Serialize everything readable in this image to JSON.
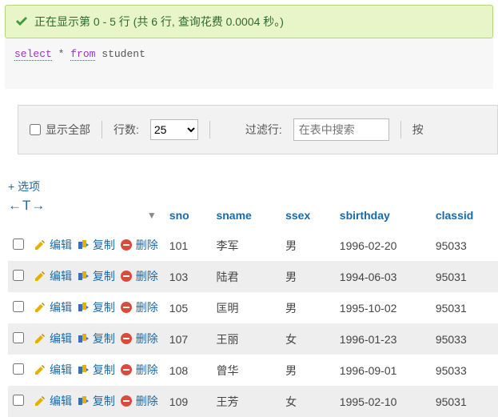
{
  "banner": {
    "text": "正在显示第 0 - 5 行 (共 6 行, 查询花费 0.0004 秒。)"
  },
  "query": {
    "kw_select": "select",
    "star": "*",
    "kw_from": "from",
    "table": "student"
  },
  "toolbar": {
    "show_all": "显示全部",
    "rows_label": "行数:",
    "rows_value": "25",
    "filter_label": "过滤行:",
    "filter_placeholder": "在表中搜索",
    "trailing": "按"
  },
  "options_link": "+ 选项",
  "modifier": "←T→",
  "sort_glyph": "▼",
  "columns": {
    "sno": "sno",
    "sname": "sname",
    "ssex": "ssex",
    "sbirthday": "sbirthday",
    "classid": "classid"
  },
  "actions": {
    "edit": "编辑",
    "copy": "复制",
    "delete": "删除"
  },
  "rows": [
    {
      "sno": "101",
      "sname": "李军",
      "ssex": "男",
      "sbirthday": "1996-02-20",
      "classid": "95033"
    },
    {
      "sno": "103",
      "sname": "陆君",
      "ssex": "男",
      "sbirthday": "1994-06-03",
      "classid": "95031"
    },
    {
      "sno": "105",
      "sname": "匡明",
      "ssex": "男",
      "sbirthday": "1995-10-02",
      "classid": "95031"
    },
    {
      "sno": "107",
      "sname": "王丽",
      "ssex": "女",
      "sbirthday": "1996-01-23",
      "classid": "95033"
    },
    {
      "sno": "108",
      "sname": "曾华",
      "ssex": "男",
      "sbirthday": "1996-09-01",
      "classid": "95033"
    },
    {
      "sno": "109",
      "sname": "王芳",
      "ssex": "女",
      "sbirthday": "1995-02-10",
      "classid": "95031"
    }
  ]
}
